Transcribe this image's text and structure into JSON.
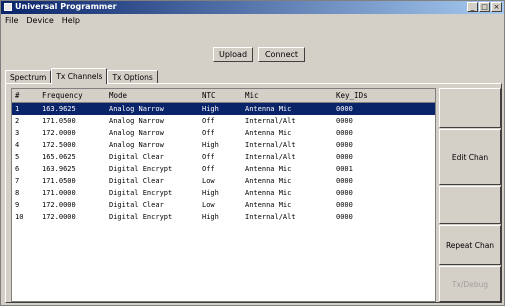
{
  "window": {
    "title": "Universal Programmer",
    "controls": {
      "minimize": "_",
      "maximize": "□",
      "close": "×"
    }
  },
  "menu": [
    "File",
    "Device",
    "Help"
  ],
  "toolbar": {
    "upload_label": "Upload",
    "connect_label": "Connect"
  },
  "tabs": [
    "Spectrum",
    "Tx Channels",
    "Tx Options"
  ],
  "table": {
    "headers": [
      "#",
      "Frequency",
      "Mode",
      "NTC",
      "Mic",
      "Key_IDs"
    ],
    "rows": [
      [
        "1",
        "163.9625",
        "Analog Narrow",
        "High",
        "Antenna Mic",
        "0000"
      ],
      [
        "2",
        "171.0500",
        "Analog Narrow",
        "Off",
        "Internal/Alt",
        "0000"
      ],
      [
        "3",
        "172.0000",
        "Analog Narrow",
        "Off",
        "Antenna Mic",
        "0000"
      ],
      [
        "4",
        "172.5000",
        "Analog Narrow",
        "High",
        "Internal/Alt",
        "0000"
      ],
      [
        "5",
        "165.0625",
        "Digital Clear",
        "Off",
        "Internal/Alt",
        "0000"
      ],
      [
        "6",
        "163.9625",
        "Digital Encrypt",
        "Off",
        "Antenna Mic",
        "0001"
      ],
      [
        "7",
        "171.0500",
        "Digital Clear",
        "Low",
        "Antenna Mic",
        "0000"
      ],
      [
        "8",
        "171.0000",
        "Digital Encrypt",
        "High",
        "Antenna Mic",
        "0000"
      ],
      [
        "9",
        "172.0000",
        "Digital Clear",
        "Low",
        "Antenna Mic",
        "0000"
      ],
      [
        "10",
        "172.0000",
        "Digital Encrypt",
        "High",
        "Internal/Alt",
        "0000"
      ]
    ],
    "selected_row": 0
  },
  "side_buttons": {
    "edit": "Edit Chan",
    "repeat": "Repeat Chan",
    "tx": "Tx/Debug"
  },
  "colors": {
    "selection": "#0a246a",
    "titlebar": "#0a246a",
    "face": "#d4d0c8"
  }
}
